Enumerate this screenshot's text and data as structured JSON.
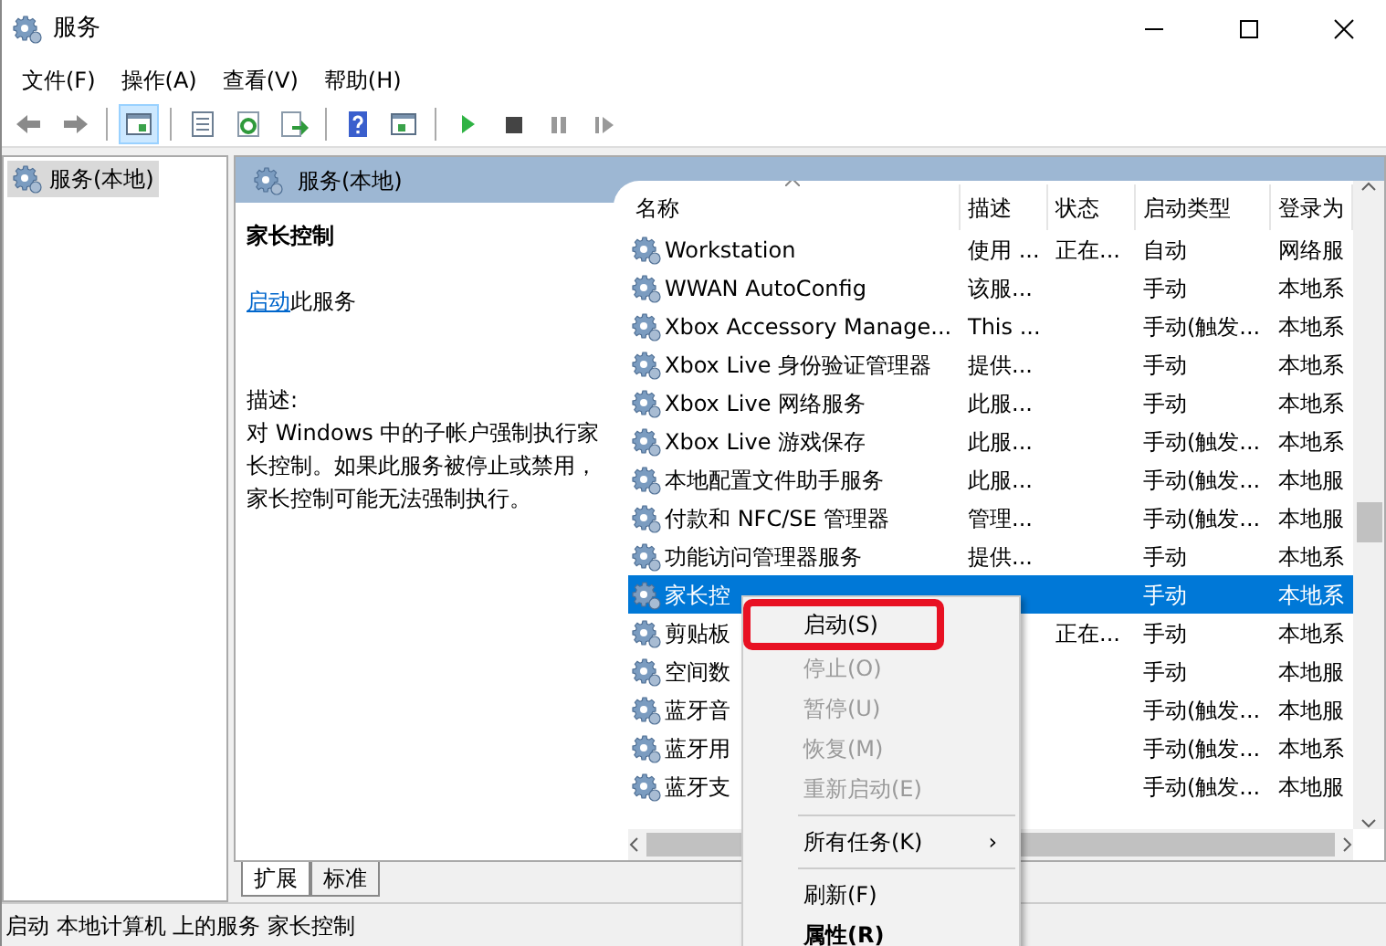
{
  "window": {
    "title": "服务"
  },
  "menu_bar": [
    "文件(F)",
    "操作(A)",
    "查看(V)",
    "帮助(H)"
  ],
  "toolbar": [
    {
      "kind": "back",
      "selected": false
    },
    {
      "kind": "forward",
      "selected": false
    },
    {
      "kind": "tree",
      "selected": true
    },
    {
      "kind": "properties",
      "selected": false
    },
    {
      "kind": "refresh",
      "selected": false
    },
    {
      "kind": "export",
      "selected": false
    },
    {
      "kind": "help",
      "selected": false
    },
    {
      "kind": "pane",
      "selected": false
    },
    {
      "kind": "play",
      "selected": false
    },
    {
      "kind": "stop",
      "selected": false
    },
    {
      "kind": "pause",
      "selected": false
    },
    {
      "kind": "resume",
      "selected": false
    }
  ],
  "tree": {
    "items": [
      {
        "label": "服务(本地)",
        "selected": true
      }
    ]
  },
  "panel": {
    "title": "服务(本地)"
  },
  "details": {
    "service_name": "家长控制",
    "action_link": "启动",
    "action_text": "此服务",
    "description_label": "描述:",
    "description": "对 Windows 中的子帐户强制执行家长控制。如果此服务被停止或禁用，家长控制可能无法强制执行。"
  },
  "table": {
    "columns": [
      "名称",
      "描述",
      "状态",
      "启动类型",
      "登录为"
    ],
    "rows": [
      {
        "name": "Workstation",
        "description": "使用 ...",
        "status": "正在...",
        "startup": "自动",
        "logon": "网络服",
        "selected": false
      },
      {
        "name": "WWAN AutoConfig",
        "description": "该服...",
        "status": "",
        "startup": "手动",
        "logon": "本地系",
        "selected": false
      },
      {
        "name": "Xbox Accessory Manage...",
        "description": "This ...",
        "status": "",
        "startup": "手动(触发...",
        "logon": "本地系",
        "selected": false
      },
      {
        "name": "Xbox Live 身份验证管理器",
        "description": "提供...",
        "status": "",
        "startup": "手动",
        "logon": "本地系",
        "selected": false
      },
      {
        "name": "Xbox Live 网络服务",
        "description": "此服...",
        "status": "",
        "startup": "手动",
        "logon": "本地系",
        "selected": false
      },
      {
        "name": "Xbox Live 游戏保存",
        "description": "此服...",
        "status": "",
        "startup": "手动(触发...",
        "logon": "本地系",
        "selected": false
      },
      {
        "name": "本地配置文件助手服务",
        "description": "此服...",
        "status": "",
        "startup": "手动(触发...",
        "logon": "本地服",
        "selected": false
      },
      {
        "name": "付款和 NFC/SE 管理器",
        "description": "管理...",
        "status": "",
        "startup": "手动(触发...",
        "logon": "本地服",
        "selected": false
      },
      {
        "name": "功能访问管理器服务",
        "description": "提供...",
        "status": "",
        "startup": "手动",
        "logon": "本地系",
        "selected": false
      },
      {
        "name": "家长控",
        "description": "",
        "status": "",
        "startup": "手动",
        "logon": "本地系",
        "selected": true
      },
      {
        "name": "剪贴板",
        "description": "",
        "status": "正在...",
        "startup": "手动",
        "logon": "本地系",
        "selected": false
      },
      {
        "name": "空间数",
        "description": "",
        "status": "",
        "startup": "手动",
        "logon": "本地服",
        "selected": false
      },
      {
        "name": "蓝牙音",
        "description": "",
        "status": "",
        "startup": "手动(触发...",
        "logon": "本地服",
        "selected": false
      },
      {
        "name": "蓝牙用",
        "description": "",
        "status": "",
        "startup": "手动(触发...",
        "logon": "本地系",
        "selected": false
      },
      {
        "name": "蓝牙支",
        "description": "",
        "status": "",
        "startup": "手动(触发...",
        "logon": "本地服",
        "selected": false
      }
    ]
  },
  "tabs": [
    {
      "label": "扩展",
      "selected": true
    },
    {
      "label": "标准",
      "selected": false
    }
  ],
  "status_bar": "启动 本地计算机 上的服务 家长控制",
  "context_menu": [
    {
      "kind": "item",
      "label": "启动(S)",
      "disabled": false,
      "highlighted": true
    },
    {
      "kind": "item",
      "label": "停止(O)",
      "disabled": true,
      "highlighted": false
    },
    {
      "kind": "item",
      "label": "暂停(U)",
      "disabled": true,
      "highlighted": false
    },
    {
      "kind": "item",
      "label": "恢复(M)",
      "disabled": true,
      "highlighted": false
    },
    {
      "kind": "item",
      "label": "重新启动(E)",
      "disabled": true,
      "highlighted": false
    },
    {
      "kind": "separator"
    },
    {
      "kind": "submenu",
      "label": "所有任务(K)",
      "arrow": "›",
      "disabled": false,
      "highlighted": false
    },
    {
      "kind": "separator"
    },
    {
      "kind": "item",
      "label": "刷新(F)",
      "disabled": false,
      "highlighted": false
    },
    {
      "kind": "bold",
      "label": "属性(R)",
      "disabled": false,
      "highlighted": false
    }
  ]
}
